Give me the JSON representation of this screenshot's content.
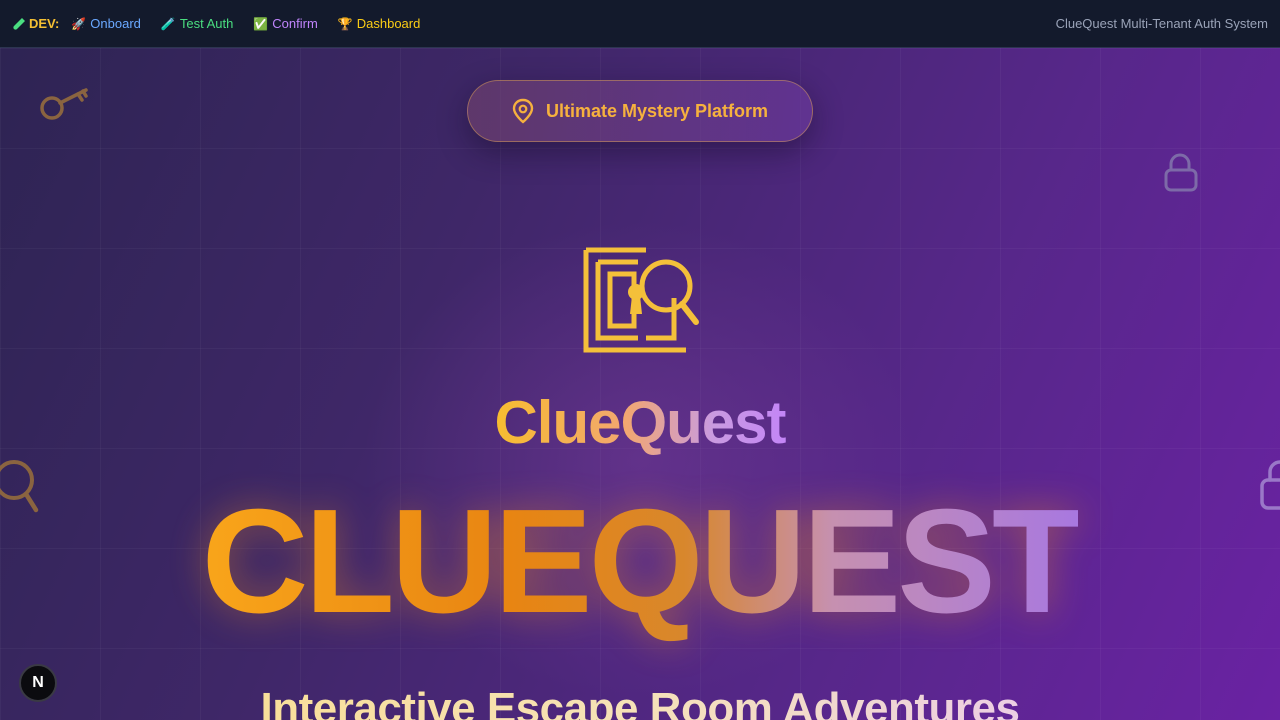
{
  "devbar": {
    "label": "DEV:",
    "links": [
      {
        "emoji": "🚀",
        "label": "Onboard",
        "color": "#6aa8ff"
      },
      {
        "emoji": "🧪",
        "label": "Test Auth",
        "color": "#4ade80"
      },
      {
        "emoji": "✅",
        "label": "Confirm",
        "color": "#c084fc"
      },
      {
        "emoji": "🏆",
        "label": "Dashboard",
        "color": "#facc15"
      }
    ],
    "system_name": "ClueQuest Multi-Tenant Auth System"
  },
  "badge": {
    "icon": "location-pin-icon",
    "text": "Ultimate Mystery Platform"
  },
  "hero": {
    "logo_icon": "maze-keyhole-magnifier-icon",
    "brand": "ClueQuest",
    "title": "CLUEQUEST",
    "subtitle": "Interactive Escape Room Adventures"
  },
  "floating_button": {
    "label": "N"
  },
  "colors": {
    "accent": "#f6b13e",
    "devbar_bg": "#131a2c",
    "background_start": "#2d2452",
    "background_end": "#6a22a3"
  }
}
